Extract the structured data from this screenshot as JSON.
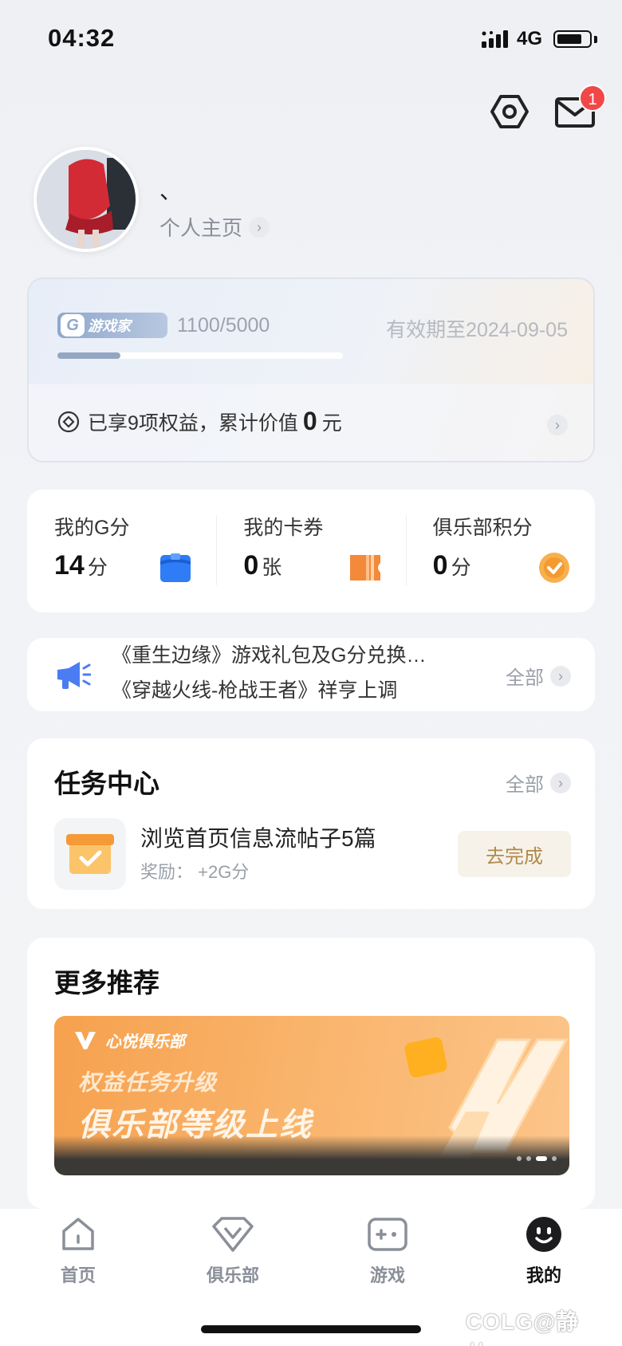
{
  "status_bar": {
    "time": "04:32",
    "network": "4G"
  },
  "header": {
    "mail_badge": "1"
  },
  "profile": {
    "name": "、",
    "home_link": "个人主页"
  },
  "member_card": {
    "level_name": "游戏家",
    "level_logo": "G",
    "progress_text": "1100/5000",
    "progress_fraction": 0.22,
    "expire_text": "有效期至2024-09-05",
    "benefits_prefix": "已享9项权益，累计价值",
    "benefits_value": "0",
    "benefits_unit": "元"
  },
  "stats": [
    {
      "label": "我的G分",
      "value": "14",
      "unit": "分",
      "icon": "box-icon"
    },
    {
      "label": "我的卡券",
      "value": "0",
      "unit": "张",
      "icon": "ticket-icon"
    },
    {
      "label": "俱乐部积分",
      "value": "0",
      "unit": "分",
      "icon": "check-coin-icon"
    }
  ],
  "notices": {
    "items": [
      "《重生边缘》游戏礼包及G分兑换…",
      "《穿越火线-枪战王者》祥亨上调"
    ],
    "all_label": "全部"
  },
  "task_center": {
    "title": "任务中心",
    "all_label": "全部",
    "task_title": "浏览首页信息流帖子5篇",
    "task_reward": "奖励： +2G分",
    "button_label": "去完成"
  },
  "more": {
    "title": "更多推荐",
    "banner_brand": "心悦俱乐部",
    "banner_subtitle": "权益任务升级",
    "banner_title": "俱乐部等级上线"
  },
  "tabs": [
    {
      "label": "首页",
      "icon": "home-icon",
      "active": false
    },
    {
      "label": "俱乐部",
      "icon": "diamond-icon",
      "active": false
    },
    {
      "label": "游戏",
      "icon": "gamepad-icon",
      "active": false
    },
    {
      "label": "我的",
      "icon": "smile-face-icon",
      "active": true
    }
  ],
  "watermark": "COLG@静儿、",
  "colors": {
    "accent_gold": "#b08a4a",
    "badge_red": "#f04848",
    "blue_icon": "#2e7cf6",
    "orange_icon": "#f4893a"
  }
}
